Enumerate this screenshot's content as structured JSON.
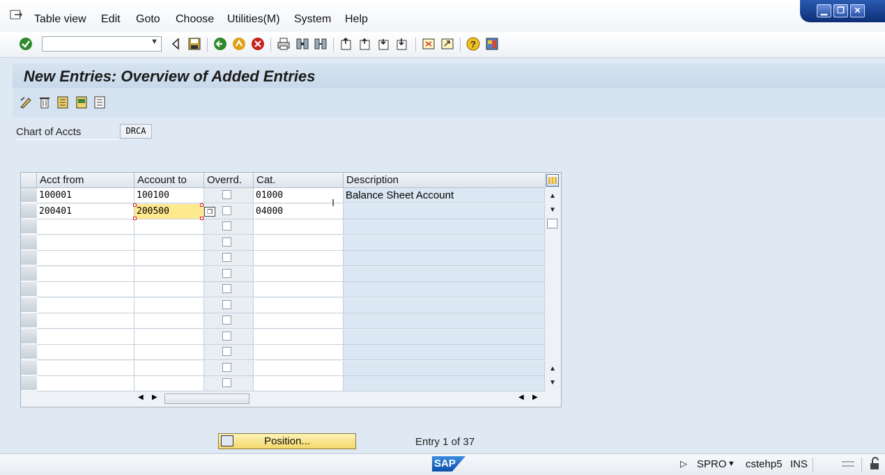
{
  "menu": [
    "Table view",
    "Edit",
    "Goto",
    "Choose",
    "Utilities(M)",
    "System",
    "Help"
  ],
  "window_controls": {
    "minimize": "▁",
    "restore": "❐",
    "close": "✕"
  },
  "command_field": {
    "value": "",
    "dropdown_icon": "▼"
  },
  "title": "New Entries: Overview of Added Entries",
  "chart_of_accts": {
    "label": "Chart of Accts",
    "value": "DRCA"
  },
  "table": {
    "columns": [
      "Acct from",
      "Account to",
      "Overrd.",
      "Cat.",
      "Description"
    ],
    "rows": [
      {
        "acct_from": "100001",
        "account_to": "100100",
        "cat": "01000",
        "description": "Balance Sheet Account"
      },
      {
        "acct_from": "200401",
        "account_to": "200500",
        "cat": "04000",
        "description": ""
      }
    ],
    "visible_rows": 13
  },
  "position_button": "Position...",
  "entry_info": "Entry 1 of 37",
  "status": {
    "transaction": "SPRO",
    "server": "cstehp5",
    "mode": "INS",
    "logo": "SAP"
  },
  "colors": {
    "title_bg": "#d6e3f0",
    "active_cell": "#ffe98f",
    "button_yellow": "#f3d86a"
  }
}
